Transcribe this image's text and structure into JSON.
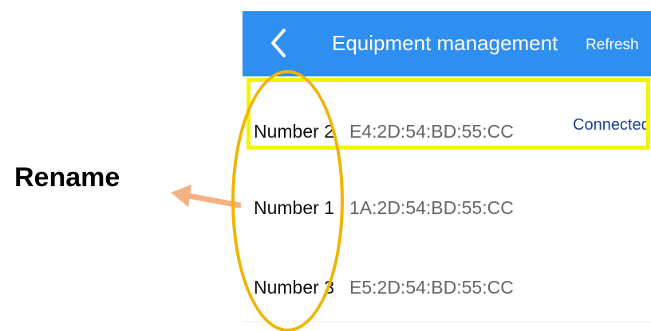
{
  "header": {
    "title": "Equipment management",
    "refresh_label": "Refresh",
    "back_icon": "chevron-left-icon",
    "background_color": "#2f8ff0"
  },
  "devices": [
    {
      "name": "Number 2",
      "mac": "E4:2D:54:BD:55:CC",
      "status": "Connected"
    },
    {
      "name": "Number 1",
      "mac": "1A:2D:54:BD:55:CC",
      "status": ""
    },
    {
      "name": "Number 3",
      "mac": "E5:2D:54:BD:55:CC",
      "status": ""
    }
  ],
  "annotation": {
    "rename_label": "Rename",
    "highlight_color": "#f4f400",
    "ellipse_color": "#f0b400",
    "arrow_color": "#f4b183"
  }
}
